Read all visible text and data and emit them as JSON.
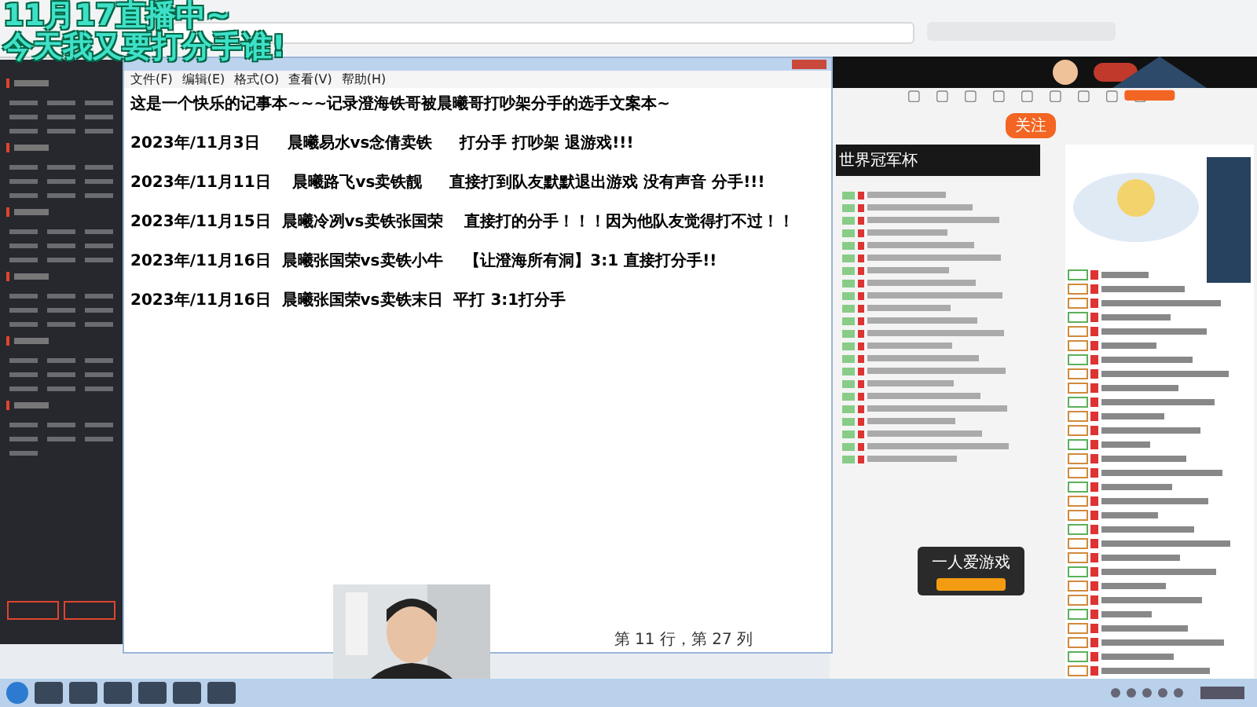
{
  "overlay": {
    "lines": [
      "11月17直播中~",
      "今天我又要打分手谁!"
    ]
  },
  "notepad": {
    "menu": [
      "文件(F)",
      "编辑(E)",
      "格式(O)",
      "查看(V)",
      "帮助(H)"
    ],
    "lines": [
      "这是一个快乐的记事本~~~记录澄海铁哥被晨曦哥打吵架分手的选手文案本~",
      "2023年/11月3日     晨曦易水vs念倩卖铁     打分手 打吵架 退游戏!!!",
      "2023年/11月11日    晨曦路飞vs卖铁靓     直接打到队友默默退出游戏 没有声音 分手!!!",
      "2023年/11月15日  晨曦冷冽vs卖铁张国荣    直接打的分手！！！因为他队友觉得打不过！！",
      "2023年/11月16日  晨曦张国荣vs卖铁小牛    【让澄海所有洞】3:1 直接打分手!!",
      "2023年/11月16日  晨曦张国荣vs卖铁末日  平打 3:1打分手"
    ],
    "status": "第 11 行，第 27 列"
  },
  "stream": {
    "banner_title": "世界冠军杯",
    "follow_button": "关注",
    "popup_title": "一人爱游戏"
  }
}
